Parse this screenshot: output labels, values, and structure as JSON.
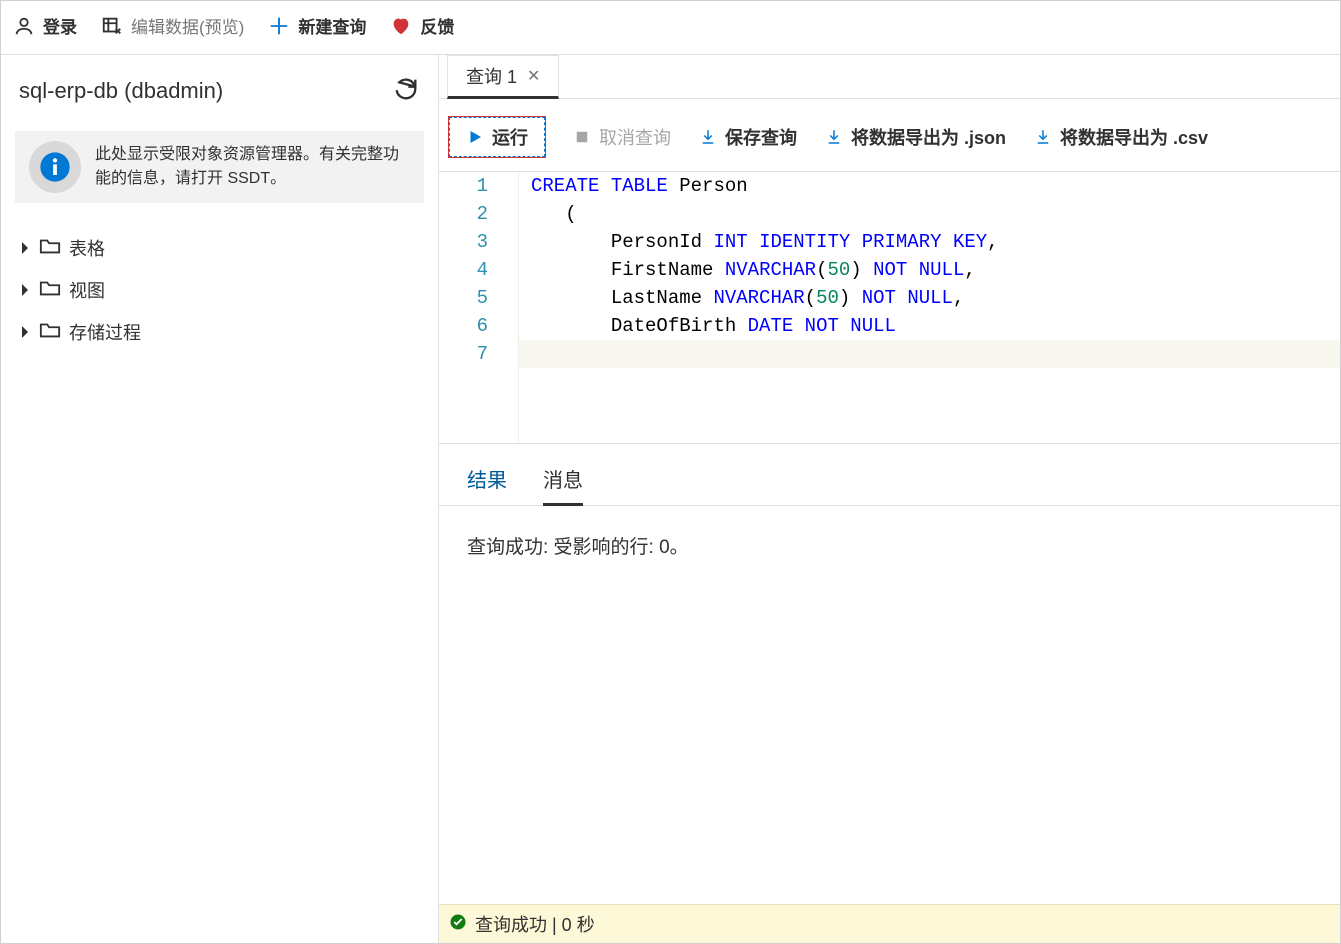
{
  "toolbar": {
    "login": "登录",
    "edit_data": "编辑数据(预览)",
    "new_query": "新建查询",
    "feedback": "反馈"
  },
  "sidebar": {
    "db_title": "sql-erp-db (dbadmin)",
    "info_text": "此处显示受限对象资源管理器。有关完整功能的信息，请打开 SSDT。",
    "tree": [
      {
        "label": "表格"
      },
      {
        "label": "视图"
      },
      {
        "label": "存储过程"
      }
    ]
  },
  "tabs": [
    {
      "label": "查询 1"
    }
  ],
  "query_toolbar": {
    "run": "运行",
    "cancel": "取消查询",
    "save": "保存查询",
    "export_json": "将数据导出为 .json",
    "export_csv": "将数据导出为 .csv"
  },
  "editor": {
    "lines": [
      {
        "n": "1",
        "tokens": [
          [
            "kw",
            "CREATE"
          ],
          [
            "sp",
            " "
          ],
          [
            "kw",
            "TABLE"
          ],
          [
            "sp",
            " "
          ],
          [
            "id",
            "Person"
          ]
        ]
      },
      {
        "n": "2",
        "tokens": [
          [
            "sp",
            "   "
          ],
          [
            "pun",
            "("
          ]
        ]
      },
      {
        "n": "3",
        "tokens": [
          [
            "sp",
            "       "
          ],
          [
            "id",
            "PersonId "
          ],
          [
            "ty",
            "INT"
          ],
          [
            "sp",
            " "
          ],
          [
            "ty",
            "IDENTITY"
          ],
          [
            "sp",
            " "
          ],
          [
            "ty",
            "PRIMARY"
          ],
          [
            "sp",
            " "
          ],
          [
            "ty",
            "KEY"
          ],
          [
            "pun",
            ","
          ]
        ]
      },
      {
        "n": "4",
        "tokens": [
          [
            "sp",
            "       "
          ],
          [
            "id",
            "FirstName "
          ],
          [
            "ty",
            "NVARCHAR"
          ],
          [
            "pun",
            "("
          ],
          [
            "num",
            "50"
          ],
          [
            "pun",
            ")"
          ],
          [
            "sp",
            " "
          ],
          [
            "ty",
            "NOT"
          ],
          [
            "sp",
            " "
          ],
          [
            "ty",
            "NULL"
          ],
          [
            "pun",
            ","
          ]
        ]
      },
      {
        "n": "5",
        "tokens": [
          [
            "sp",
            "       "
          ],
          [
            "id",
            "LastName "
          ],
          [
            "ty",
            "NVARCHAR"
          ],
          [
            "pun",
            "("
          ],
          [
            "num",
            "50"
          ],
          [
            "pun",
            ")"
          ],
          [
            "sp",
            " "
          ],
          [
            "ty",
            "NOT"
          ],
          [
            "sp",
            " "
          ],
          [
            "ty",
            "NULL"
          ],
          [
            "pun",
            ","
          ]
        ]
      },
      {
        "n": "6",
        "tokens": [
          [
            "sp",
            "       "
          ],
          [
            "id",
            "DateOfBirth "
          ],
          [
            "ty",
            "DATE"
          ],
          [
            "sp",
            " "
          ],
          [
            "ty",
            "NOT"
          ],
          [
            "sp",
            " "
          ],
          [
            "ty",
            "NULL"
          ]
        ]
      },
      {
        "n": "7",
        "tokens": [
          [
            "sp",
            "   "
          ],
          [
            "pun",
            ")"
          ]
        ]
      }
    ]
  },
  "result_tabs": {
    "results": "结果",
    "messages": "消息"
  },
  "result_message": "查询成功: 受影响的行: 0。",
  "status": "查询成功 | 0 秒"
}
